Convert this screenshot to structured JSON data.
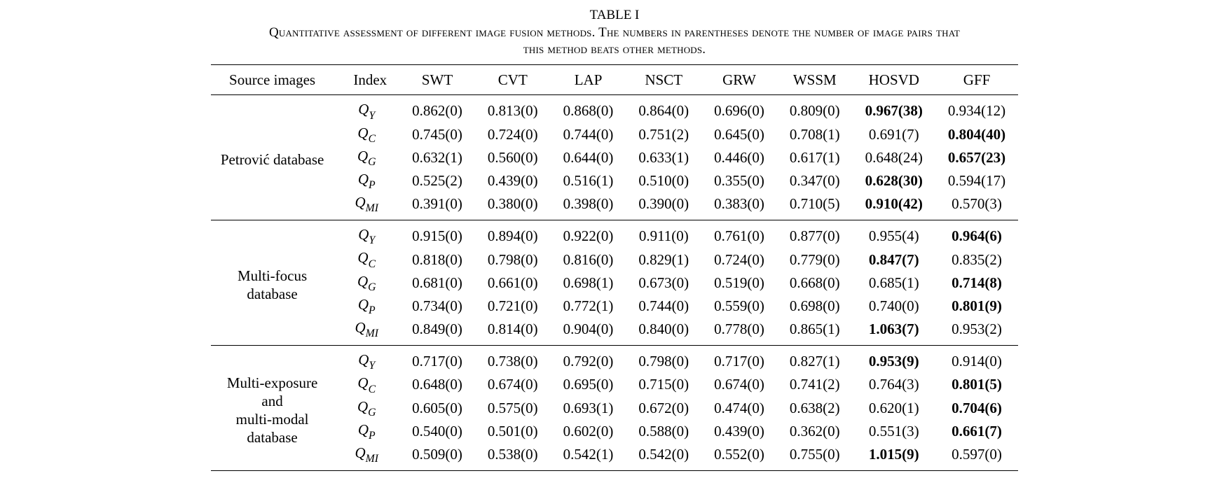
{
  "caption": {
    "label": "TABLE I",
    "text_line1": "Quantitative assessment of different image fusion methods. The numbers in parentheses denote the number of image pairs that",
    "text_line2": "this method beats other methods."
  },
  "headers": {
    "source": "Source images",
    "index": "Index",
    "methods": [
      "SWT",
      "CVT",
      "LAP",
      "NSCT",
      "GRW",
      "WSSM",
      "HOSVD",
      "GFF"
    ]
  },
  "chart_data": {
    "type": "table",
    "groups": [
      {
        "source": "Petrović database",
        "rows": [
          {
            "index": "Q",
            "sub": "Y",
            "cells": [
              {
                "v": "0.862(0)"
              },
              {
                "v": "0.813(0)"
              },
              {
                "v": "0.868(0)"
              },
              {
                "v": "0.864(0)"
              },
              {
                "v": "0.696(0)"
              },
              {
                "v": "0.809(0)"
              },
              {
                "v": "0.967(38)",
                "b": true
              },
              {
                "v": "0.934(12)"
              }
            ]
          },
          {
            "index": "Q",
            "sub": "C",
            "cells": [
              {
                "v": "0.745(0)"
              },
              {
                "v": "0.724(0)"
              },
              {
                "v": "0.744(0)"
              },
              {
                "v": "0.751(2)"
              },
              {
                "v": "0.645(0)"
              },
              {
                "v": "0.708(1)"
              },
              {
                "v": "0.691(7)"
              },
              {
                "v": "0.804(40)",
                "b": true
              }
            ]
          },
          {
            "index": "Q",
            "sub": "G",
            "cells": [
              {
                "v": "0.632(1)"
              },
              {
                "v": "0.560(0)"
              },
              {
                "v": "0.644(0)"
              },
              {
                "v": "0.633(1)"
              },
              {
                "v": "0.446(0)"
              },
              {
                "v": "0.617(1)"
              },
              {
                "v": "0.648(24)"
              },
              {
                "v": "0.657(23)",
                "b": true
              }
            ]
          },
          {
            "index": "Q",
            "sub": "P",
            "cells": [
              {
                "v": "0.525(2)"
              },
              {
                "v": "0.439(0)"
              },
              {
                "v": "0.516(1)"
              },
              {
                "v": "0.510(0)"
              },
              {
                "v": "0.355(0)"
              },
              {
                "v": "0.347(0)"
              },
              {
                "v": "0.628(30)",
                "b": true
              },
              {
                "v": "0.594(17)"
              }
            ]
          },
          {
            "index": "Q",
            "sub": "MI",
            "cells": [
              {
                "v": "0.391(0)"
              },
              {
                "v": "0.380(0)"
              },
              {
                "v": "0.398(0)"
              },
              {
                "v": "0.390(0)"
              },
              {
                "v": "0.383(0)"
              },
              {
                "v": "0.710(5)"
              },
              {
                "v": "0.910(42)",
                "b": true
              },
              {
                "v": "0.570(3)"
              }
            ]
          }
        ]
      },
      {
        "source": "Multi-focus\ndatabase",
        "rows": [
          {
            "index": "Q",
            "sub": "Y",
            "cells": [
              {
                "v": "0.915(0)"
              },
              {
                "v": "0.894(0)"
              },
              {
                "v": "0.922(0)"
              },
              {
                "v": "0.911(0)"
              },
              {
                "v": "0.761(0)"
              },
              {
                "v": "0.877(0)"
              },
              {
                "v": "0.955(4)"
              },
              {
                "v": "0.964(6)",
                "b": true
              }
            ]
          },
          {
            "index": "Q",
            "sub": "C",
            "cells": [
              {
                "v": "0.818(0)"
              },
              {
                "v": "0.798(0)"
              },
              {
                "v": "0.816(0)"
              },
              {
                "v": "0.829(1)"
              },
              {
                "v": "0.724(0)"
              },
              {
                "v": "0.779(0)"
              },
              {
                "v": "0.847(7)",
                "b": true
              },
              {
                "v": "0.835(2)"
              }
            ]
          },
          {
            "index": "Q",
            "sub": "G",
            "cells": [
              {
                "v": "0.681(0)"
              },
              {
                "v": "0.661(0)"
              },
              {
                "v": "0.698(1)"
              },
              {
                "v": "0.673(0)"
              },
              {
                "v": "0.519(0)"
              },
              {
                "v": "0.668(0)"
              },
              {
                "v": "0.685(1)"
              },
              {
                "v": "0.714(8)",
                "b": true
              }
            ]
          },
          {
            "index": "Q",
            "sub": "P",
            "cells": [
              {
                "v": "0.734(0)"
              },
              {
                "v": "0.721(0)"
              },
              {
                "v": "0.772(1)"
              },
              {
                "v": "0.744(0)"
              },
              {
                "v": "0.559(0)"
              },
              {
                "v": "0.698(0)"
              },
              {
                "v": "0.740(0)"
              },
              {
                "v": "0.801(9)",
                "b": true
              }
            ]
          },
          {
            "index": "Q",
            "sub": "MI",
            "cells": [
              {
                "v": "0.849(0)"
              },
              {
                "v": "0.814(0)"
              },
              {
                "v": "0.904(0)"
              },
              {
                "v": "0.840(0)"
              },
              {
                "v": "0.778(0)"
              },
              {
                "v": "0.865(1)"
              },
              {
                "v": "1.063(7)",
                "b": true
              },
              {
                "v": "0.953(2)"
              }
            ]
          }
        ]
      },
      {
        "source": "Multi-exposure\nand\nmulti-modal\ndatabase",
        "rows": [
          {
            "index": "Q",
            "sub": "Y",
            "cells": [
              {
                "v": "0.717(0)"
              },
              {
                "v": "0.738(0)"
              },
              {
                "v": "0.792(0)"
              },
              {
                "v": "0.798(0)"
              },
              {
                "v": "0.717(0)"
              },
              {
                "v": "0.827(1)"
              },
              {
                "v": "0.953(9)",
                "b": true
              },
              {
                "v": "0.914(0)"
              }
            ]
          },
          {
            "index": "Q",
            "sub": "C",
            "cells": [
              {
                "v": "0.648(0)"
              },
              {
                "v": "0.674(0)"
              },
              {
                "v": "0.695(0)"
              },
              {
                "v": "0.715(0)"
              },
              {
                "v": "0.674(0)"
              },
              {
                "v": "0.741(2)"
              },
              {
                "v": "0.764(3)"
              },
              {
                "v": "0.801(5)",
                "b": true
              }
            ]
          },
          {
            "index": "Q",
            "sub": "G",
            "cells": [
              {
                "v": "0.605(0)"
              },
              {
                "v": "0.575(0)"
              },
              {
                "v": "0.693(1)"
              },
              {
                "v": "0.672(0)"
              },
              {
                "v": "0.474(0)"
              },
              {
                "v": "0.638(2)"
              },
              {
                "v": "0.620(1)"
              },
              {
                "v": "0.704(6)",
                "b": true
              }
            ]
          },
          {
            "index": "Q",
            "sub": "P",
            "cells": [
              {
                "v": "0.540(0)"
              },
              {
                "v": "0.501(0)"
              },
              {
                "v": "0.602(0)"
              },
              {
                "v": "0.588(0)"
              },
              {
                "v": "0.439(0)"
              },
              {
                "v": "0.362(0)"
              },
              {
                "v": "0.551(3)"
              },
              {
                "v": "0.661(7)",
                "b": true
              }
            ]
          },
          {
            "index": "Q",
            "sub": "MI",
            "cells": [
              {
                "v": "0.509(0)"
              },
              {
                "v": "0.538(0)"
              },
              {
                "v": "0.542(1)"
              },
              {
                "v": "0.542(0)"
              },
              {
                "v": "0.552(0)"
              },
              {
                "v": "0.755(0)"
              },
              {
                "v": "1.015(9)",
                "b": true
              },
              {
                "v": "0.597(0)"
              }
            ]
          }
        ]
      }
    ]
  }
}
